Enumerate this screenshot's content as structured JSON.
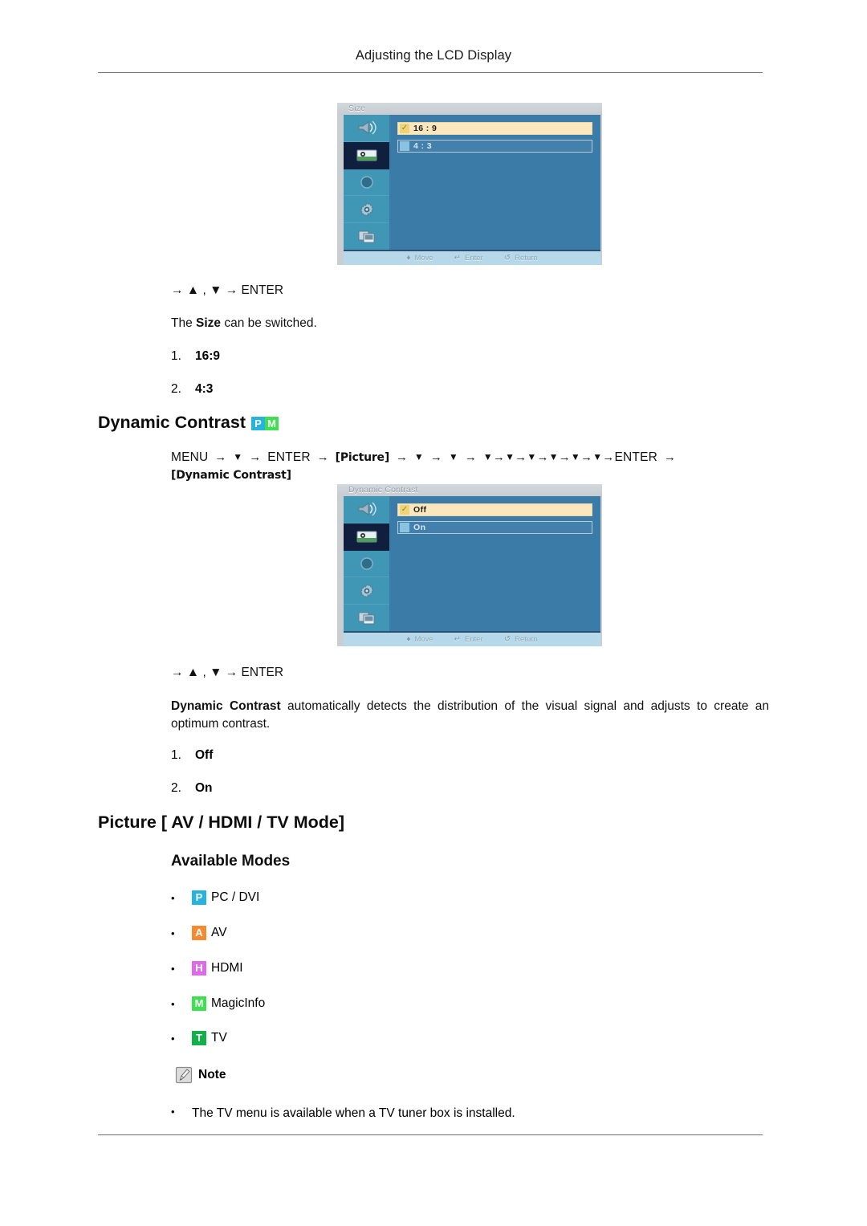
{
  "document": {
    "header_title": "Adjusting the LCD Display"
  },
  "size_section": {
    "osd": {
      "title": "Size",
      "options": [
        {
          "label": "16 : 9",
          "selected": true
        },
        {
          "label": "4 : 3",
          "selected": false
        }
      ],
      "footer_hints": [
        {
          "icon": "move-updown-icon",
          "glyph": "♦",
          "label": "Move"
        },
        {
          "icon": "enter-key-icon",
          "glyph": "↵",
          "label": "Enter"
        },
        {
          "icon": "return-arrow-icon",
          "glyph": "↺",
          "label": "Return"
        }
      ],
      "sidebar_icons": [
        "sound-speaker-icon",
        "picture-image-icon",
        "setup-circle-icon",
        "gear-settings-icon",
        "multi-control-monitor-icon"
      ],
      "active_sidebar_index": 1
    },
    "nav_hint": "→ ▲ , ▼ → ENTER",
    "description": "The Size can be switched.",
    "description_bold": "Size",
    "items": [
      {
        "num": "1.",
        "value": "16:9"
      },
      {
        "num": "2.",
        "value": "4:3"
      }
    ]
  },
  "dynamic_contrast_section": {
    "heading": "Dynamic Contrast",
    "heading_badges": [
      {
        "letter": "P",
        "name": "pc-dvi-badge",
        "color": "#26b3e0"
      },
      {
        "letter": "M",
        "name": "magicinfo-badge",
        "color": "#3ce050"
      }
    ],
    "menu_path": {
      "parts": [
        {
          "type": "text",
          "value": "MENU"
        },
        {
          "type": "arrow",
          "value": "→"
        },
        {
          "type": "down",
          "value": "▼"
        },
        {
          "type": "arrow",
          "value": "→"
        },
        {
          "type": "text",
          "value": "ENTER"
        },
        {
          "type": "arrow",
          "value": "→"
        },
        {
          "type": "tag",
          "value": "[Picture]"
        },
        {
          "type": "arrow",
          "value": "→"
        },
        {
          "type": "down",
          "value": "▼"
        },
        {
          "type": "arrow",
          "value": "→"
        },
        {
          "type": "down",
          "value": "▼"
        },
        {
          "type": "arrow",
          "value": "→"
        },
        {
          "type": "down",
          "value": "▼"
        },
        {
          "type": "arrow_tight",
          "value": "→"
        },
        {
          "type": "down",
          "value": "▼"
        },
        {
          "type": "arrow_tight",
          "value": "→"
        },
        {
          "type": "down",
          "value": "▼"
        },
        {
          "type": "arrow_tight",
          "value": "→"
        },
        {
          "type": "down",
          "value": "▼"
        },
        {
          "type": "arrow_tight",
          "value": "→"
        },
        {
          "type": "down",
          "value": "▼"
        },
        {
          "type": "arrow_tight",
          "value": "→"
        },
        {
          "type": "down",
          "value": "▼"
        },
        {
          "type": "arrow_tight",
          "value": "→"
        },
        {
          "type": "text",
          "value": "ENTER"
        },
        {
          "type": "arrow",
          "value": "→"
        }
      ],
      "tail_tag": "[Dynamic Contrast]"
    },
    "osd": {
      "title": "Dynamic Contrast",
      "options": [
        {
          "label": "Off",
          "selected": true
        },
        {
          "label": "On",
          "selected": false
        }
      ],
      "footer_hints": [
        {
          "icon": "move-updown-icon",
          "glyph": "♦",
          "label": "Move"
        },
        {
          "icon": "enter-key-icon",
          "glyph": "↵",
          "label": "Enter"
        },
        {
          "icon": "return-arrow-icon",
          "glyph": "↺",
          "label": "Return"
        }
      ],
      "sidebar_icons": [
        "sound-speaker-icon",
        "picture-image-icon",
        "setup-circle-icon",
        "gear-settings-icon",
        "multi-control-monitor-icon"
      ],
      "active_sidebar_index": 1
    },
    "nav_hint": "→ ▲ , ▼ → ENTER",
    "description_bold": "Dynamic Contrast",
    "description_rest": " automatically detects the distribution of the visual signal and adjusts to create an optimum contrast.",
    "items": [
      {
        "num": "1.",
        "value": "Off"
      },
      {
        "num": "2.",
        "value": "On"
      }
    ]
  },
  "picture_av_section": {
    "heading": "Picture [ AV / HDMI / TV Mode]",
    "subheading": "Available Modes",
    "modes": [
      {
        "badge": "P",
        "badge_name": "pc-dvi-badge",
        "color": "#26b3e0",
        "label": "PC / DVI"
      },
      {
        "badge": "A",
        "badge_name": "av-badge",
        "color": "#f58a33",
        "label": "AV"
      },
      {
        "badge": "H",
        "badge_name": "hdmi-badge",
        "color": "#dd6ae8",
        "label": "HDMI"
      },
      {
        "badge": "M",
        "badge_name": "magicinfo-badge",
        "color": "#3ce050",
        "label": "MagicInfo"
      },
      {
        "badge": "T",
        "badge_name": "tv-badge",
        "color": "#12b04a",
        "label": "TV"
      }
    ],
    "note": {
      "label": "Note",
      "icon": "note-pencil-icon",
      "bullet": "•",
      "text": "The TV menu is available when a TV tuner box is installed."
    }
  }
}
